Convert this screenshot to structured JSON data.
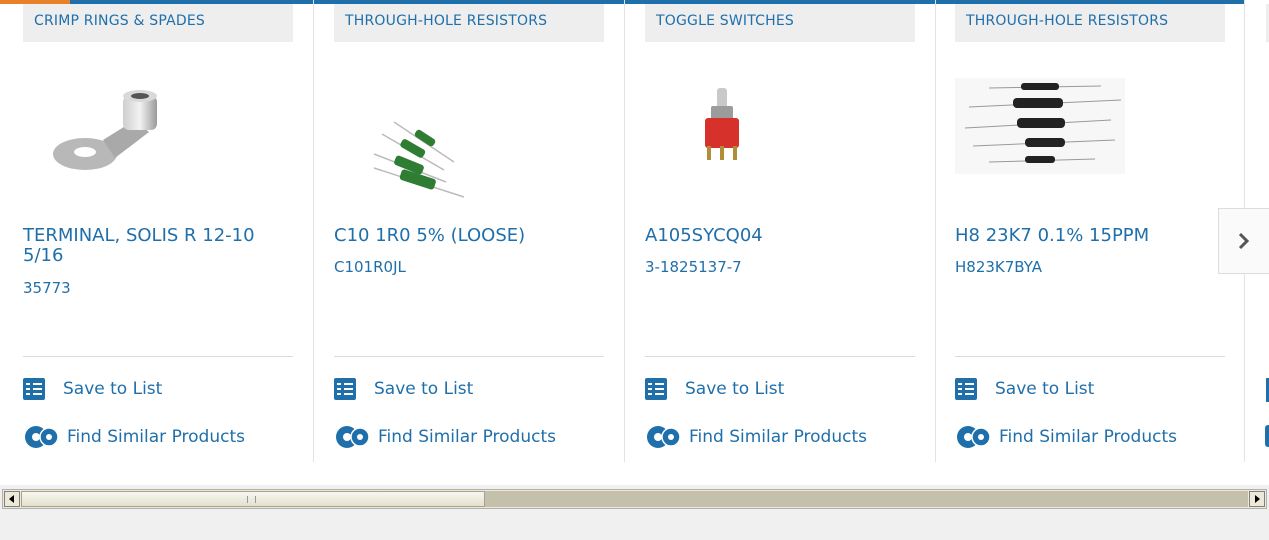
{
  "products": [
    {
      "category": "CRIMP RINGS & SPADES",
      "title": "TERMINAL, SOLIS R 12-10 5/16",
      "part_number": "35773",
      "image_icon": "ring-terminal-image",
      "save_label": "Save to List",
      "find_label": "Find Similar Products"
    },
    {
      "category": "THROUGH-HOLE RESISTORS",
      "title": "C10 1R0 5% (LOOSE)",
      "part_number": "C101R0JL",
      "image_icon": "green-resistors-image",
      "save_label": "Save to List",
      "find_label": "Find Similar Products"
    },
    {
      "category": "TOGGLE SWITCHES",
      "title": "A105SYCQ04",
      "part_number": "3-1825137-7",
      "image_icon": "toggle-switch-image",
      "save_label": "Save to List",
      "find_label": "Find Similar Products"
    },
    {
      "category": "THROUGH-HOLE RESISTORS",
      "title": "H8 23K7 0.1% 15PPM",
      "part_number": "H823K7BYA",
      "image_icon": "black-resistors-image",
      "save_label": "Save to List",
      "find_label": "Find Similar Products"
    }
  ],
  "colors": {
    "link_blue": "#1f6faa",
    "accent_orange": "#e8822a",
    "category_bg": "#eeeeee"
  },
  "carousel": {
    "next_icon": "chevron-right-icon"
  }
}
